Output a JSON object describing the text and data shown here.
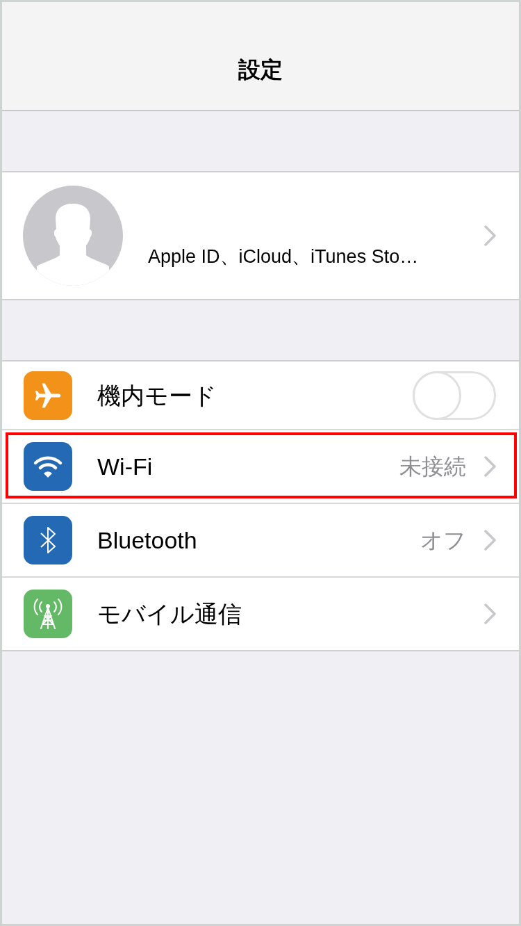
{
  "nav_bar": {
    "title": "設定"
  },
  "account": {
    "text": "Apple ID、iCloud、iTunes Sto…"
  },
  "settings": [
    {
      "kind": "toggle",
      "label": "機内モード",
      "color": "#f39219",
      "on": false,
      "highlighted": false
    },
    {
      "kind": "link",
      "label": "Wi-Fi",
      "value": "未接続",
      "color": "#2469b3",
      "highlighted": true
    },
    {
      "kind": "link",
      "label": "Bluetooth",
      "value": "オフ",
      "color": "#2469b3",
      "highlighted": false
    },
    {
      "kind": "link",
      "label": "モバイル通信",
      "color": "#63b966",
      "highlighted": false
    }
  ]
}
